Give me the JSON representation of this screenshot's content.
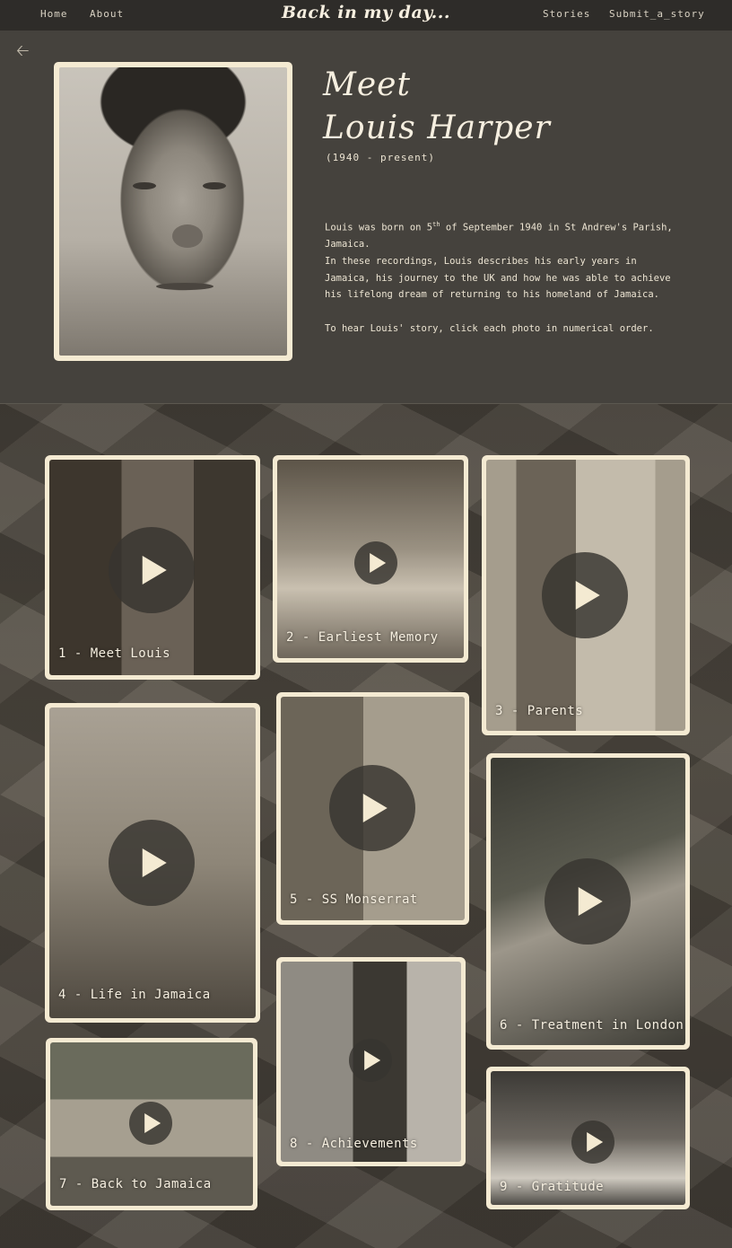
{
  "nav": {
    "home": "Home",
    "about": "About",
    "title": "Back in my day...",
    "stories": "Stories",
    "submit": "Submit_a_story"
  },
  "hero": {
    "back_icon": "arrow-left-icon",
    "heading_line1": "Meet",
    "heading_line2": "Louis Harper",
    "dates": "(1940 - present)",
    "bio": {
      "line1_pre": "Louis was born on 5",
      "line1_sup": "th",
      "line1_post": " of September 1940 in St Andrew's Parish, Jamaica.",
      "line2": "In these recordings, Louis describes his early years in Jamaica, his journey to the UK and how he was able to achieve his lifelong dream of returning to his homeland of Jamaica.",
      "line3": "To hear Louis' story, click each photo in numerical order."
    }
  },
  "videos": [
    {
      "label": "1 - Meet Louis"
    },
    {
      "label": "2 - Earliest Memory"
    },
    {
      "label": "3 - Parents"
    },
    {
      "label": "4 - Life in Jamaica"
    },
    {
      "label": "5 - SS Monserrat"
    },
    {
      "label": "6 - Treatment in London"
    },
    {
      "label": "7 - Back to Jamaica"
    },
    {
      "label": "8 - Achievements"
    },
    {
      "label": "9 - Gratitude"
    }
  ],
  "icons": {
    "play": "play-icon"
  },
  "colors": {
    "background": "#45423d",
    "topbar": "#2e2c29",
    "frame": "#f4ead2",
    "text": "#f3ecdc"
  }
}
